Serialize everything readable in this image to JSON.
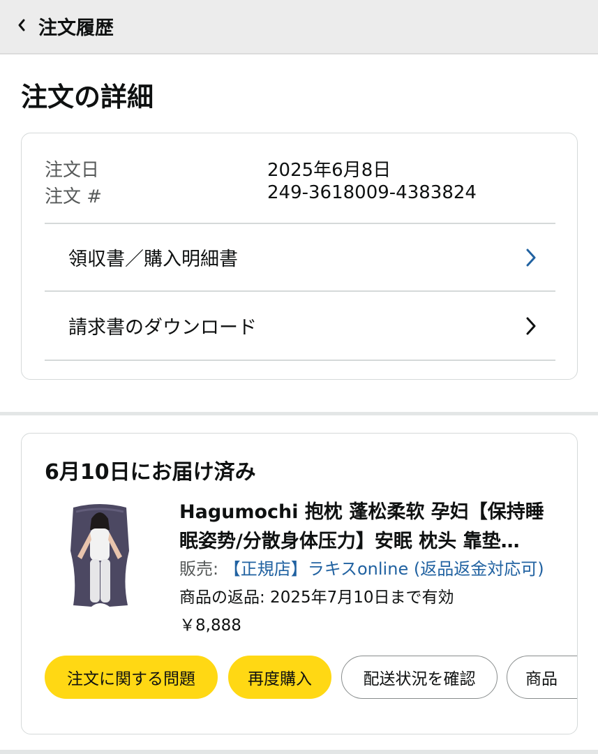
{
  "header": {
    "back_title": "注文履歴"
  },
  "page": {
    "title": "注文の詳細"
  },
  "summary": {
    "order_date_label": "注文日",
    "order_date_value": "2025年6月8日",
    "order_number_label": "注文 #",
    "order_number_value": "249-3618009-4383824",
    "links": [
      {
        "label": "領収書／購入明細書",
        "chevron_color": "#2162a1"
      },
      {
        "label": "請求書のダウンロード",
        "chevron_color": "#0f1111"
      }
    ]
  },
  "shipment": {
    "status": "6月10日にお届け済み",
    "product": {
      "title_line1": "Hagumochi 抱枕 蓬松柔软 孕妇【保持睡",
      "title_line2": "眠姿势/分散身体压力】安眠 枕头 靠垫…",
      "seller_prefix": "販売: ",
      "seller_name": "【正規店】ラキスonline (返品返金対応可)",
      "return_policy": "商品の返品: 2025年7月10日まで有効",
      "price": "￥8,888"
    },
    "buttons": [
      "注文に関する問題",
      "再度購入",
      "配送状況を確認",
      "商品"
    ]
  },
  "colors": {
    "primary_button": "#ffd814",
    "link": "#2162a1",
    "header_bg": "#ececec"
  }
}
